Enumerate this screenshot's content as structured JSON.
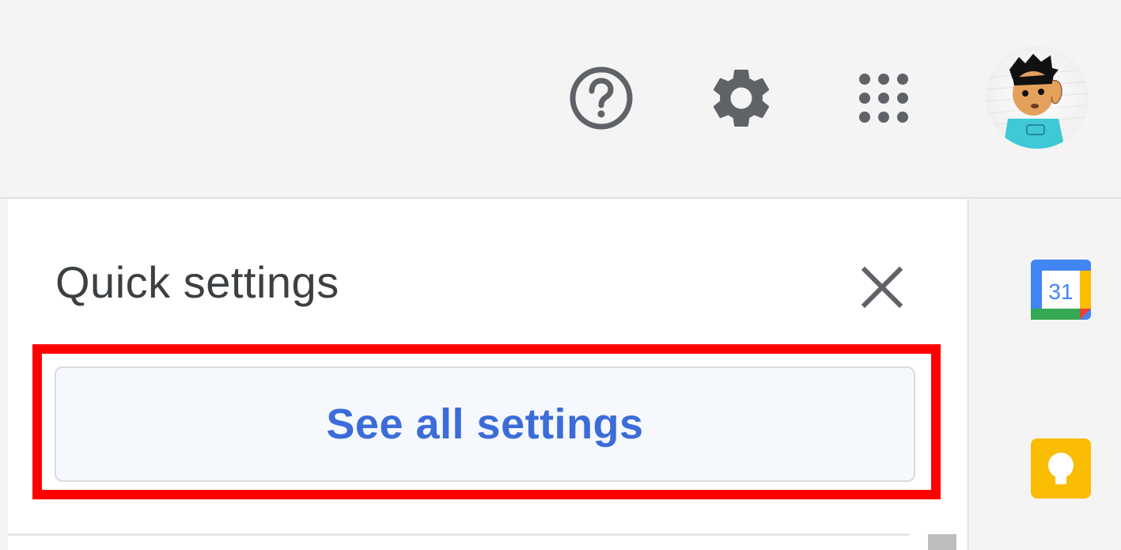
{
  "header": {
    "help_icon": "help-circle-icon",
    "settings_icon": "gear-icon",
    "apps_icon": "apps-grid-icon",
    "avatar_icon": "account-avatar"
  },
  "quick_settings": {
    "title": "Quick settings",
    "close_icon": "close-icon",
    "see_all_label": "See all settings",
    "highlight_color": "#ff0000",
    "button_text_color": "#3b6cd8"
  },
  "side_panel": {
    "apps": [
      {
        "name": "calendar",
        "label": "31",
        "icon": "calendar-icon"
      },
      {
        "name": "keep",
        "icon": "keep-lightbulb-icon"
      }
    ]
  }
}
